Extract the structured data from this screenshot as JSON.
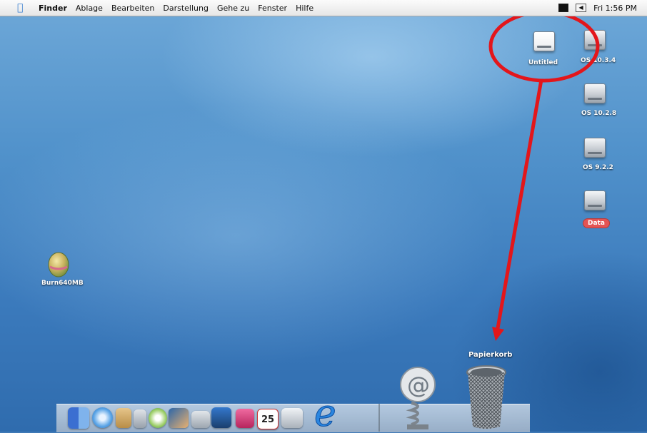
{
  "menubar": {
    "items": [
      "Finder",
      "Ablage",
      "Bearbeiten",
      "Darstellung",
      "Gehe zu",
      "Fenster",
      "Hilfe"
    ],
    "clock": "Fri 1:56 PM"
  },
  "desktop_icons": {
    "untitled": "Untitled",
    "os1034": "OS 10.3.4",
    "os1028": "OS 10.2.8",
    "os922": "OS 9.2.2",
    "data": "Data",
    "burn": "Burn640MB"
  },
  "dock": {
    "trash_label": "Papierkorb",
    "calendar_day": "25"
  },
  "colors": {
    "annotation": "#e3161b",
    "data_label": "#e45454"
  }
}
